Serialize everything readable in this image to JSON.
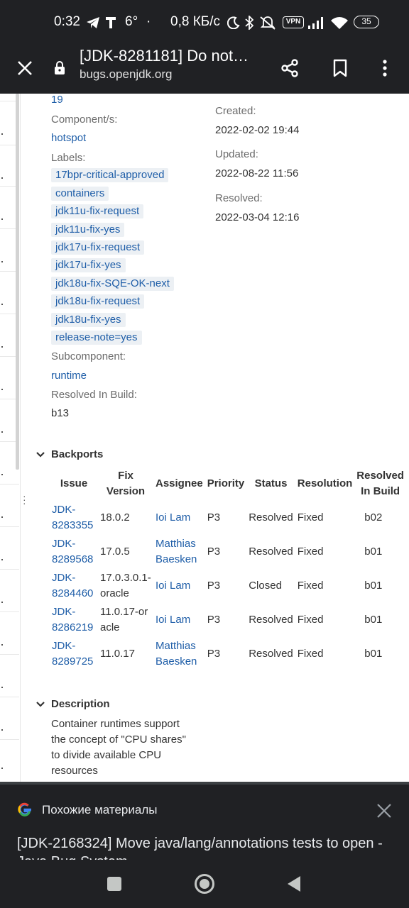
{
  "status_bar": {
    "time": "0:32",
    "temperature": "6°",
    "speed": "0,8 КБ/с",
    "vpn": "VPN",
    "battery": "35",
    "icons": [
      "telegram-icon",
      "t-icon",
      "moon-icon",
      "bluetooth-icon",
      "mute-icon",
      "signal-icon",
      "wifi-icon"
    ]
  },
  "toolbar": {
    "title": "[JDK-8281181] Do not…",
    "url": "bugs.openjdk.org",
    "icons": [
      "close-icon",
      "lock-icon",
      "share-icon",
      "bookmark-icon",
      "more-icon"
    ]
  },
  "details": {
    "fix_version_value": "19",
    "component_label": "Component/s:",
    "component_value": "hotspot",
    "labels_label": "Labels:",
    "labels": [
      "17bpr-critical-approved",
      "containers",
      "jdk11u-fix-request",
      "jdk11u-fix-yes",
      "jdk17u-fix-request",
      "jdk17u-fix-yes",
      "jdk18u-fix-SQE-OK-next",
      "jdk18u-fix-request",
      "jdk18u-fix-yes",
      "release-note=yes"
    ],
    "subcomponent_label": "Subcomponent:",
    "subcomponent_value": "runtime",
    "resolved_build_label": "Resolved In Build:",
    "resolved_build_value": "b13"
  },
  "dates": {
    "created_label": "Created:",
    "created_value": "2022-02-02 19:44",
    "updated_label": "Updated:",
    "updated_value": "2022-08-22 11:56",
    "resolved_label": "Resolved:",
    "resolved_value": "2022-03-04 12:16"
  },
  "backports": {
    "title": "Backports",
    "columns": [
      "Issue",
      "Fix Version",
      "Assignee",
      "Priority",
      "Status",
      "Resolution",
      "Resolved In Build"
    ],
    "rows": [
      {
        "issue": "JDK-8283355",
        "fix": "18.0.2",
        "assignee": "Ioi Lam",
        "priority": "P3",
        "status": "Resolved",
        "resolution": "Fixed",
        "build": "b02"
      },
      {
        "issue": "JDK-8289568",
        "fix": "17.0.5",
        "assignee": "Matthias Baesken",
        "priority": "P3",
        "status": "Resolved",
        "resolution": "Fixed",
        "build": "b01"
      },
      {
        "issue": "JDK-8284460",
        "fix": "17.0.3.0.1-oracle",
        "assignee": "Ioi Lam",
        "priority": "P3",
        "status": "Closed",
        "resolution": "Fixed",
        "build": "b01"
      },
      {
        "issue": "JDK-8286219",
        "fix": "11.0.17-oracle",
        "assignee": "Ioi Lam",
        "priority": "P3",
        "status": "Resolved",
        "resolution": "Fixed",
        "build": "b01"
      },
      {
        "issue": "JDK-8289725",
        "fix": "11.0.17",
        "assignee": "Matthias Baesken",
        "priority": "P3",
        "status": "Resolved",
        "resolution": "Fixed",
        "build": "b01"
      }
    ]
  },
  "description": {
    "title": "Description",
    "text": "Container runtimes support the concept of \"CPU shares\" to divide available CPU resources"
  },
  "suggestions": {
    "heading": "Похожие материалы",
    "item": "[JDK-2168324] Move java/lang/annotations tests to open - Java Bug System"
  },
  "nav": {
    "icons": [
      "recents-icon",
      "home-icon",
      "back-icon"
    ]
  },
  "colors": {
    "chrome_bg": "#202124",
    "link": "#1f5ea8",
    "tag_bg": "#ecf0f4"
  }
}
